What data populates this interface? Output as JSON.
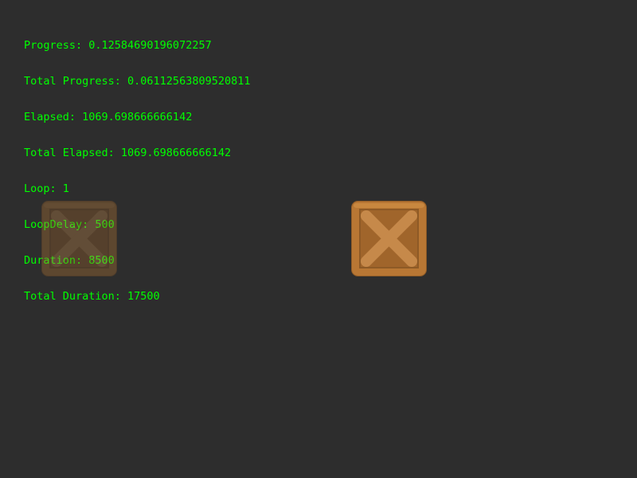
{
  "debug": {
    "progress": "Progress: 0.12584690196072257",
    "total_progress": "Total Progress: 0.06112563809520811",
    "elapsed": "Elapsed: 1069.698666666142",
    "total_elapsed": "Total Elapsed: 1069.698666666142",
    "loop": "Loop: 1",
    "loop_delay": "LoopDelay: 500",
    "duration": "Duration: 8500",
    "total_duration": "Total Duration: 17500",
    "text_color": "#00ff00"
  },
  "scene": {
    "background_color": "#2d2d2d",
    "sprites": [
      {
        "name": "crate",
        "icon": "crate-icon",
        "role": "start-position-ghost",
        "alpha": 0.35
      },
      {
        "name": "crate",
        "icon": "crate-icon",
        "role": "tweened-sprite",
        "alpha": 1.0
      }
    ]
  },
  "colors": {
    "crate_frame": "#b87734",
    "crate_frame_light": "#c8873f",
    "crate_panel": "#a0652b",
    "crate_cross": "#c6894a",
    "crate_edge": "#8e5a26"
  }
}
